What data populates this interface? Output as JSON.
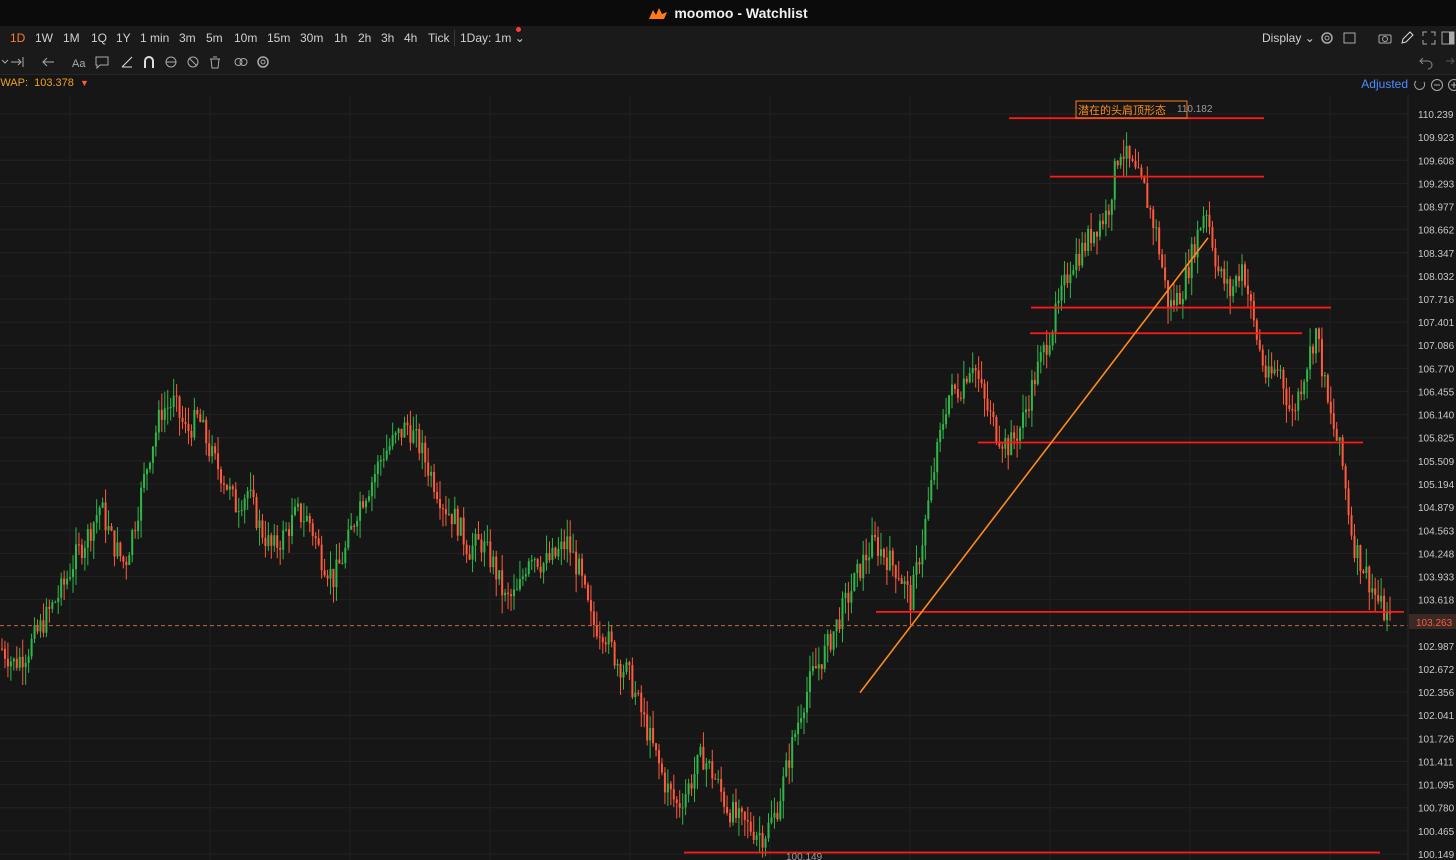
{
  "window": {
    "title": "moomoo - Watchlist"
  },
  "toolbar": {
    "timeframes": [
      "1D",
      "1W",
      "1M",
      "1Q",
      "1Y",
      "1 min",
      "3m",
      "5m",
      "10m",
      "15m",
      "30m",
      "1h",
      "2h",
      "3h",
      "4h",
      "Tick"
    ],
    "active_timeframe": "1D",
    "period_select": "1Day: 1m",
    "display_label": "Display"
  },
  "indicator": {
    "vwap_label": "VWAP:",
    "vwap_value": "103.378"
  },
  "adjusted_label": "Adjusted",
  "price_axis": [
    "110.239",
    "109.923",
    "109.608",
    "109.293",
    "108.977",
    "108.662",
    "108.347",
    "108.032",
    "107.716",
    "107.401",
    "107.086",
    "106.770",
    "106.455",
    "106.140",
    "105.825",
    "105.509",
    "105.194",
    "104.879",
    "104.563",
    "104.248",
    "103.933",
    "103.618",
    "102.987",
    "102.672",
    "102.356",
    "102.041",
    "101.726",
    "101.411",
    "101.095",
    "100.780",
    "100.465",
    "100.149"
  ],
  "current_price": "103.263",
  "annotations": {
    "pattern_label": "潜在的头肩顶形态",
    "high_value": "110.182",
    "low_value": "100.149"
  },
  "colors": {
    "up": "#2fb84a",
    "down": "#ff5a3c",
    "line": "#ff1a1a",
    "trend": "#ff8a1e",
    "accent": "#ff7a2a"
  },
  "chart_data": {
    "type": "candlestick",
    "interval": "1m",
    "y_range": [
      100.0,
      110.4
    ],
    "close_series": [
      102.95,
      102.75,
      102.9,
      103.2,
      103.5,
      103.8,
      104.2,
      104.5,
      104.9,
      104.4,
      104.1,
      104.8,
      105.6,
      106.2,
      106.3,
      105.9,
      106.1,
      105.6,
      105.3,
      104.9,
      105.1,
      104.6,
      104.3,
      104.5,
      104.8,
      104.7,
      104.2,
      103.9,
      104.3,
      104.9,
      105.2,
      105.6,
      105.8,
      106.0,
      105.7,
      105.3,
      104.9,
      104.7,
      104.3,
      104.4,
      104.1,
      103.6,
      103.7,
      104.3,
      104.1,
      104.2,
      104.4,
      104.0,
      103.3,
      103.2,
      102.8,
      102.6,
      102.1,
      101.6,
      101.1,
      100.8,
      101.1,
      101.5,
      101.2,
      100.8,
      100.6,
      100.5,
      100.4,
      100.7,
      101.4,
      102.1,
      102.6,
      102.9,
      103.3,
      103.7,
      104.1,
      104.4,
      104.2,
      104.0,
      103.6,
      104.5,
      105.5,
      106.4,
      106.5,
      106.9,
      106.3,
      105.9,
      105.7,
      106.0,
      106.6,
      107.1,
      107.6,
      108.2,
      108.4,
      108.7,
      108.9,
      109.8,
      109.5,
      109.2,
      108.6,
      107.6,
      107.8,
      108.4,
      109.0,
      108.1,
      107.8,
      108.2,
      107.3,
      106.6,
      106.8,
      106.1,
      106.7,
      107.3,
      106.2,
      105.6,
      104.4,
      104.0,
      103.6,
      103.3
    ]
  }
}
